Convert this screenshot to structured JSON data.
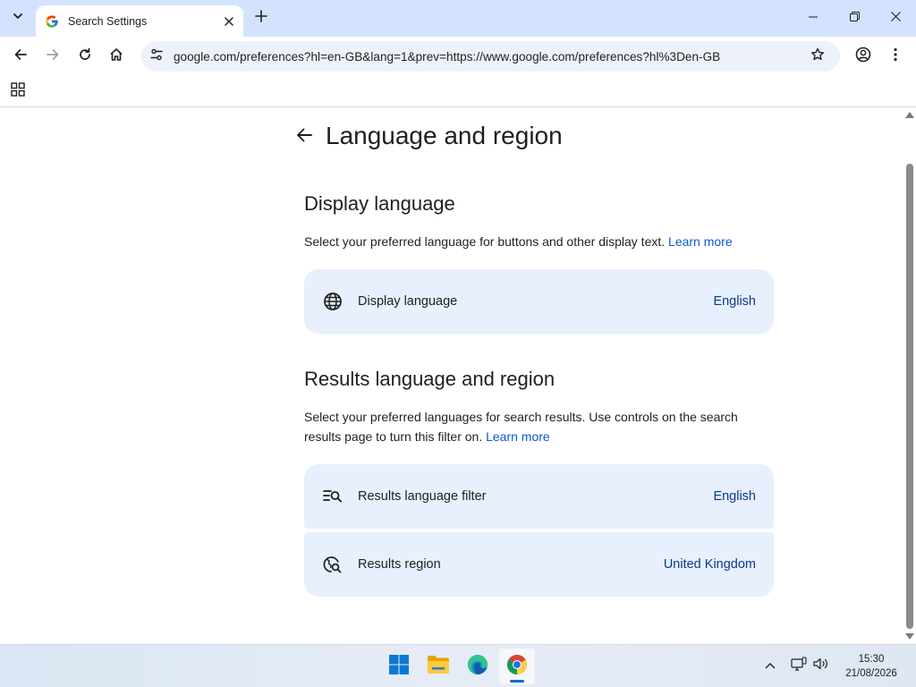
{
  "colors": {
    "tabstrip_bg": "#d3e3fd",
    "omnibox_bg": "#edf2fa",
    "card_bg": "#e8effd",
    "link": "#0b57d0",
    "card_value": "#0b3a8c"
  },
  "browser": {
    "tab": {
      "title": "Search Settings",
      "favicon": "google-g-icon"
    },
    "address_bar": {
      "url": "google.com/preferences?hl=en-GB&lang=1&prev=https://www.google.com/preferences?hl%3Den-GB"
    }
  },
  "page": {
    "title": "Language and region",
    "sections": [
      {
        "heading": "Display language",
        "description": "Select your preferred language for buttons and other display text.",
        "learn_more": "Learn more",
        "cards": [
          {
            "icon": "globe-icon",
            "label": "Display language",
            "value": "English"
          }
        ]
      },
      {
        "heading": "Results language and region",
        "description": "Select your preferred languages for search results. Use controls on the search results page to turn this filter on.",
        "learn_more": "Learn more",
        "cards": [
          {
            "icon": "language-filter-icon",
            "label": "Results language filter",
            "value": "English"
          },
          {
            "icon": "region-search-icon",
            "label": "Results region",
            "value": "United Kingdom"
          }
        ]
      }
    ]
  },
  "taskbar": {
    "apps": [
      "windows-start-icon",
      "file-explorer-icon",
      "edge-icon",
      "chrome-icon"
    ],
    "active_app": "chrome-icon",
    "clock": {
      "time": "15:30",
      "date": "21/08/2026"
    }
  }
}
